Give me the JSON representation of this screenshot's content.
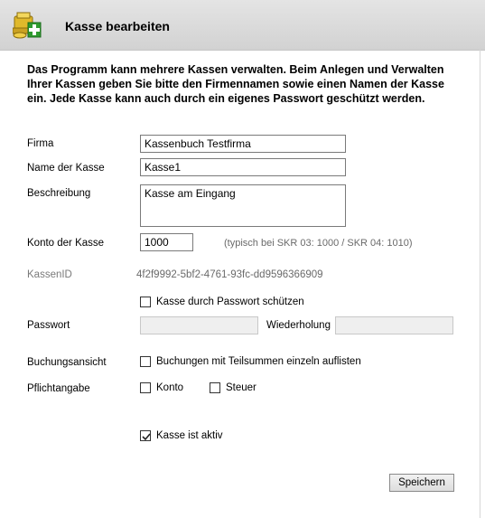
{
  "header": {
    "title": "Kasse bearbeiten",
    "icon": "cash-register-add-icon"
  },
  "intro": "Das Programm kann mehrere Kassen verwalten. Beim Anlegen und Verwalten Ihrer Kassen geben Sie bitte den Firmennamen sowie einen Namen der Kasse ein. Jede Kasse kann auch durch ein eigenes Passwort geschützt werden.",
  "form": {
    "firma": {
      "label": "Firma",
      "value": "Kassenbuch Testfirma"
    },
    "name": {
      "label": "Name der Kasse",
      "value": "Kasse1"
    },
    "beschreibung": {
      "label": "Beschreibung",
      "value": "Kasse am Eingang"
    },
    "konto": {
      "label": "Konto der Kasse",
      "value": "1000",
      "hint": "(typisch bei SKR 03: 1000 / SKR 04: 1010)"
    },
    "kassenid": {
      "label": "KassenID",
      "value": "4f2f9992-5bf2-4761-93fc-dd9596366909"
    },
    "passwort_schutz": {
      "label": "Kasse durch Passwort schützen",
      "checked": false
    },
    "passwort": {
      "label": "Passwort",
      "value": ""
    },
    "wiederholung": {
      "label": "Wiederholung",
      "value": ""
    },
    "buchungsansicht": {
      "label": "Buchungsansicht",
      "option_label": "Buchungen mit Teilsummen einzeln auflisten",
      "checked": false
    },
    "pflichtangabe": {
      "label": "Pflichtangabe",
      "konto_label": "Konto",
      "konto_checked": false,
      "steuer_label": "Steuer",
      "steuer_checked": false
    },
    "aktiv": {
      "label": "Kasse ist aktiv",
      "checked": true
    }
  },
  "buttons": {
    "save": "Speichern"
  }
}
